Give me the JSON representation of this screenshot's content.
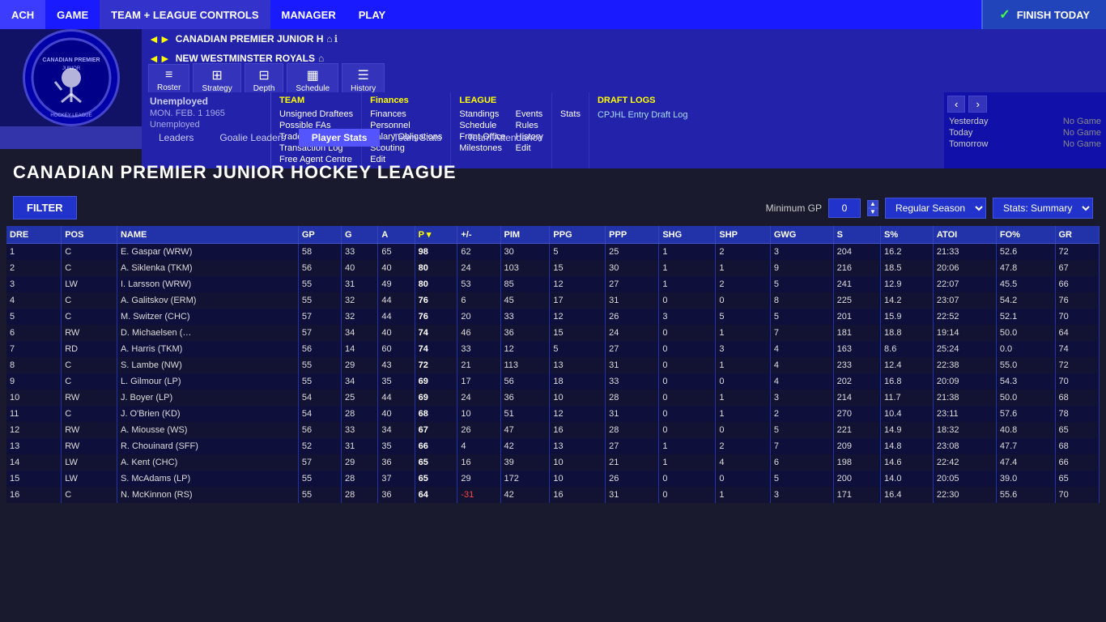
{
  "topnav": {
    "items": [
      {
        "id": "ach",
        "label": "ACH"
      },
      {
        "id": "game",
        "label": "GAME"
      },
      {
        "id": "team_league",
        "label": "TEAM + LEAGUE CONTROLS",
        "active": true
      },
      {
        "id": "manager",
        "label": "MANAGER"
      },
      {
        "id": "play",
        "label": "PLAY"
      }
    ],
    "finish_today": "FINISH TODAY"
  },
  "nav": {
    "team1": "CANADIAN PREMIER JUNIOR H",
    "team2": "NEW WESTMINSTER ROYALS",
    "icons": [
      {
        "label": "Roster"
      },
      {
        "label": "Strategy"
      },
      {
        "label": "Depth"
      },
      {
        "label": "Schedule"
      },
      {
        "label": "History"
      }
    ]
  },
  "manager": {
    "status": "Unemployed",
    "date": "MON. FEB. 1 1965",
    "team": "Unemployed"
  },
  "team_menu": {
    "header": "TEAM",
    "items": [
      "Unsigned Draftees",
      "Possible FAs",
      "Trade Offer",
      "Transaction Log",
      "Free Agent Centre"
    ]
  },
  "finances_menu": {
    "header": "Finances",
    "items": [
      "Finances",
      "Personnel",
      "Salary Obligations",
      "Scouting",
      "Edit"
    ]
  },
  "league_menu": {
    "header": "LEAGUE",
    "items": [
      "Standings",
      "Events",
      "Schedule",
      "Rules",
      "Front Office",
      "History",
      "Milestones",
      "Edit"
    ]
  },
  "stats_menu": {
    "header": "",
    "items": [
      "Stats"
    ]
  },
  "draft_logs": {
    "title": "DRAFT LOGS",
    "link": "CPJHL Entry Draft Log"
  },
  "game_schedule": {
    "yesterday": {
      "label": "Yesterday",
      "value": "No Game"
    },
    "today": {
      "label": "Today",
      "value": "No Game"
    },
    "tomorrow": {
      "label": "Tomorrow",
      "value": "No Game"
    }
  },
  "tabs": [
    {
      "id": "leaders",
      "label": "Leaders"
    },
    {
      "id": "goalie_leaders",
      "label": "Goalie Leaders"
    },
    {
      "id": "player_stats",
      "label": "Player Stats",
      "active": true
    },
    {
      "id": "team_stats",
      "label": "Team Stats"
    },
    {
      "id": "team_attendance",
      "label": "Team Attendance"
    }
  ],
  "league_title": "CANADIAN PREMIER JUNIOR HOCKEY LEAGUE",
  "filter": {
    "label": "FILTER",
    "min_gp_label": "Minimum GP",
    "min_gp_value": "0",
    "season_options": [
      "Regular Season"
    ],
    "stats_options": [
      "Stats: Summary"
    ]
  },
  "table": {
    "headers": [
      "DRE",
      "POS",
      "NAME",
      "GP",
      "G",
      "A",
      "P",
      "+/-",
      "PIM",
      "PPG",
      "PPP",
      "SHG",
      "SHP",
      "GWG",
      "S",
      "S%",
      "ATOI",
      "FO%",
      "GR"
    ],
    "rows": [
      [
        1,
        "C",
        "E. Gaspar (WRW)",
        58,
        33,
        65,
        98,
        62,
        30,
        5,
        25,
        1,
        2,
        3,
        204,
        "16.2",
        "21:33",
        "52.6",
        72
      ],
      [
        2,
        "C",
        "A. Siklenka (TKM)",
        56,
        40,
        40,
        80,
        24,
        103,
        15,
        30,
        1,
        1,
        9,
        216,
        "18.5",
        "20:06",
        "47.8",
        67
      ],
      [
        3,
        "LW",
        "I. Larsson (WRW)",
        55,
        31,
        49,
        80,
        53,
        85,
        12,
        27,
        1,
        2,
        5,
        241,
        "12.9",
        "22:07",
        "45.5",
        66
      ],
      [
        4,
        "C",
        "A. Galitskov (ERM)",
        55,
        32,
        44,
        76,
        6,
        45,
        17,
        31,
        0,
        0,
        8,
        225,
        "14.2",
        "23:07",
        "54.2",
        76
      ],
      [
        5,
        "C",
        "M. Switzer (CHC)",
        57,
        32,
        44,
        76,
        20,
        33,
        12,
        26,
        3,
        5,
        5,
        201,
        "15.9",
        "22:52",
        "52.1",
        70
      ],
      [
        6,
        "RW",
        "D. Michaelsen (…",
        57,
        34,
        40,
        74,
        46,
        36,
        15,
        24,
        0,
        1,
        7,
        181,
        "18.8",
        "19:14",
        "50.0",
        64
      ],
      [
        7,
        "RD",
        "A. Harris (TKM)",
        56,
        14,
        60,
        74,
        33,
        12,
        5,
        27,
        0,
        3,
        4,
        163,
        "8.6",
        "25:24",
        "0.0",
        74
      ],
      [
        8,
        "C",
        "S. Lambe (NW)",
        55,
        29,
        43,
        72,
        21,
        113,
        13,
        31,
        0,
        1,
        4,
        233,
        "12.4",
        "22:38",
        "55.0",
        72
      ],
      [
        9,
        "C",
        "L. Gilmour (LP)",
        55,
        34,
        35,
        69,
        17,
        56,
        18,
        33,
        0,
        0,
        4,
        202,
        "16.8",
        "20:09",
        "54.3",
        70
      ],
      [
        10,
        "RW",
        "J. Boyer (LP)",
        54,
        25,
        44,
        69,
        24,
        36,
        10,
        28,
        0,
        1,
        3,
        214,
        "11.7",
        "21:38",
        "50.0",
        68
      ],
      [
        11,
        "C",
        "J. O'Brien (KD)",
        54,
        28,
        40,
        68,
        10,
        51,
        12,
        31,
        0,
        1,
        2,
        270,
        "10.4",
        "23:11",
        "57.6",
        78
      ],
      [
        12,
        "RW",
        "A. Miousse (WS)",
        56,
        33,
        34,
        67,
        26,
        47,
        16,
        28,
        0,
        0,
        5,
        221,
        "14.9",
        "18:32",
        "40.8",
        65
      ],
      [
        13,
        "RW",
        "R. Chouinard (SFF)",
        52,
        31,
        35,
        66,
        4,
        42,
        13,
        27,
        1,
        2,
        7,
        209,
        "14.8",
        "23:08",
        "47.7",
        68
      ],
      [
        14,
        "LW",
        "A. Kent (CHC)",
        57,
        29,
        36,
        65,
        16,
        39,
        10,
        21,
        1,
        4,
        6,
        198,
        "14.6",
        "22:42",
        "47.4",
        66
      ],
      [
        15,
        "LW",
        "S. McAdams (LP)",
        55,
        28,
        37,
        65,
        29,
        172,
        10,
        26,
        0,
        0,
        5,
        200,
        "14.0",
        "20:05",
        "39.0",
        65
      ],
      [
        16,
        "C",
        "N. McKinnon (RS)",
        55,
        28,
        36,
        64,
        -31,
        42,
        16,
        31,
        0,
        1,
        3,
        171,
        "16.4",
        "22:30",
        "55.6",
        70
      ]
    ]
  }
}
